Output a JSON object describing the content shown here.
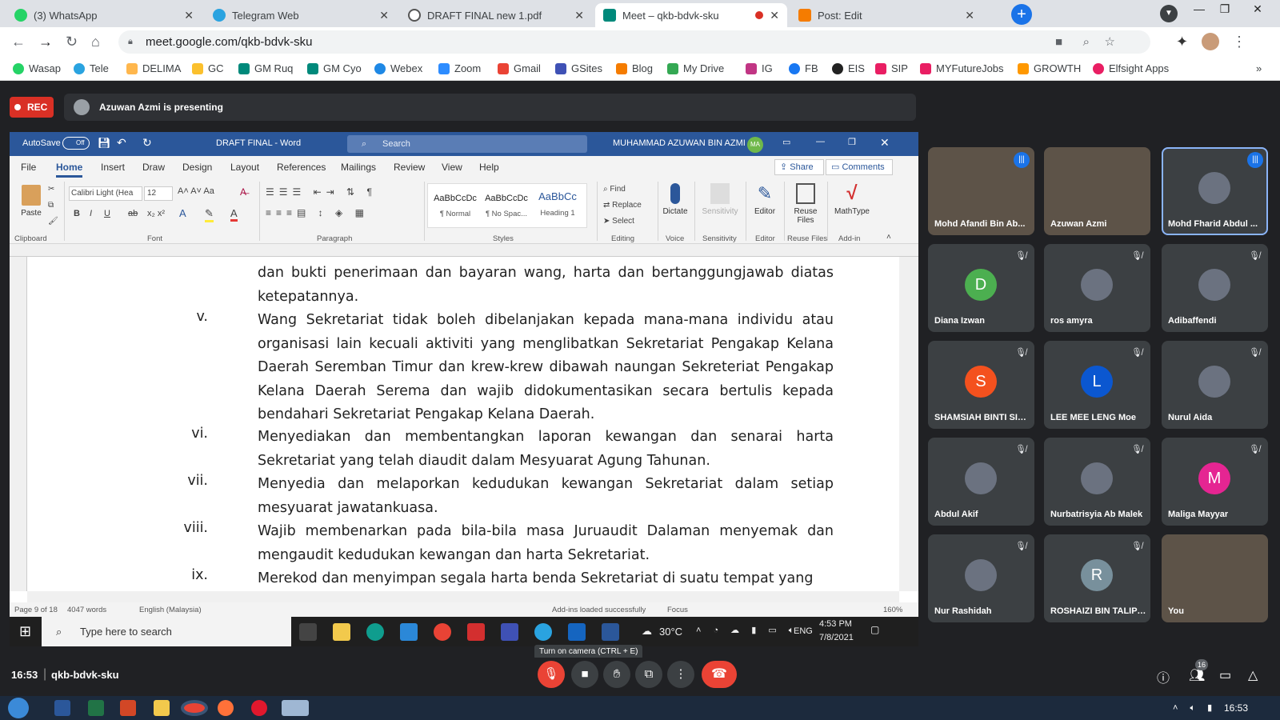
{
  "browser": {
    "tabs": [
      {
        "label": "(3) WhatsApp",
        "color": "#25d366"
      },
      {
        "label": "Telegram Web",
        "color": "#2aa3e0"
      },
      {
        "label": "DRAFT FINAL new 1.pdf",
        "color": "#555555"
      },
      {
        "label": "Meet – qkb-bdvk-sku",
        "color": "#00897b"
      },
      {
        "label": "Post: Edit",
        "color": "#f57c00"
      }
    ],
    "url": "meet.google.com/qkb-bdvk-sku",
    "bookmarks": [
      "Wasap",
      "Tele",
      "DELIMA",
      "GC",
      "GM Ruq",
      "GM Cyo",
      "Webex",
      "Zoom",
      "Gmail",
      "GSites",
      "Blog",
      "My Drive",
      "IG",
      "FB",
      "EIS",
      "SIP",
      "MYFutureJobs",
      "GROWTH",
      "Elfsight Apps"
    ]
  },
  "meet": {
    "rec_label": "REC",
    "presenting": "Azuwan Azmi is presenting",
    "time": "16:53",
    "meeting_code": "qkb-bdvk-sku",
    "tooltip": "Turn on camera (CTRL + E)",
    "people_count": "16",
    "participants": [
      {
        "name": "Mohd Afandi Bin Ab...",
        "kind": "video"
      },
      {
        "name": "Azuwan Azmi",
        "kind": "video"
      },
      {
        "name": "Mohd Fharid Abdul ...",
        "kind": "photo"
      },
      {
        "name": "Diana Izwan",
        "kind": "letter",
        "letter": "D",
        "color": "#4caf50"
      },
      {
        "name": "ros amyra",
        "kind": "photo"
      },
      {
        "name": "Adibaffendi",
        "kind": "photo"
      },
      {
        "name": "SHAMSIAH BINTI SID...",
        "kind": "letter",
        "letter": "S",
        "color": "#f4511e"
      },
      {
        "name": "LEE MEE LENG Moe",
        "kind": "letter",
        "letter": "L",
        "color": "#0b57d0"
      },
      {
        "name": "Nurul Aida",
        "kind": "photo"
      },
      {
        "name": "Abdul Akif",
        "kind": "photo"
      },
      {
        "name": "Nurbatrisyia Ab Malek",
        "kind": "photo"
      },
      {
        "name": "Maliga Mayyar",
        "kind": "letter",
        "letter": "M",
        "color": "#e52592"
      },
      {
        "name": "Nur Rashidah",
        "kind": "photo"
      },
      {
        "name": "ROSHAIZI BIN TALIP ...",
        "kind": "letter",
        "letter": "R",
        "color": "#78909c"
      },
      {
        "name": "You",
        "kind": "video"
      }
    ]
  },
  "word": {
    "autosave": "AutoSave",
    "autosave_state": "Off",
    "title": "DRAFT FINAL - Word",
    "search": "Search",
    "user": "MUHAMMAD AZUWAN BIN AZMI",
    "user_initials": "MA",
    "share": "Share",
    "comments": "Comments",
    "menu": [
      "File",
      "Home",
      "Insert",
      "Draw",
      "Design",
      "Layout",
      "References",
      "Mailings",
      "Review",
      "View",
      "Help"
    ],
    "font": "Calibri Light (Hea",
    "size": "12",
    "styles": [
      {
        "preview": "AaBbCcDc",
        "name": "¶ Normal"
      },
      {
        "preview": "AaBbCcDc",
        "name": "¶ No Spac..."
      },
      {
        "preview": "AaBbCc",
        "name": "Heading 1"
      }
    ],
    "editing": [
      "Find",
      "Replace",
      "Select"
    ],
    "buttons": [
      "Dictate",
      "Sensitivity",
      "Editor",
      "Reuse Files",
      "MathType"
    ],
    "groups": [
      "Clipboard",
      "Font",
      "Paragraph",
      "Styles",
      "Editing",
      "Voice",
      "Sensitivity",
      "Editor",
      "Reuse Files",
      "Add-in"
    ],
    "paste": "Paste",
    "status": {
      "page": "Page 9 of 18",
      "words": "4047 words",
      "lang": "English (Malaysia)",
      "addins": "Add-ins loaded successfully",
      "focus": "Focus",
      "zoom": "160%"
    },
    "items": [
      {
        "num": "",
        "text": "dan bukti penerimaan dan bayaran wang, harta dan bertanggungjawab diatas ketepatannya."
      },
      {
        "num": "v.",
        "text": "Wang Sekretariat tidak boleh dibelanjakan kepada mana-mana individu atau organisasi lain kecuali aktiviti yang menglibatkan Sekretariat Pengakap Kelana Daerah Seremban Timur dan krew-krew dibawah naungan Sekreteriat Pengakap Kelana Daerah Serema dan wajib didokumentasikan secara bertulis kepada bendahari Sekretariat Pengakap Kelana Daerah."
      },
      {
        "num": "vi.",
        "text": "Menyediakan dan membentangkan laporan kewangan dan senarai harta Sekretariat yang telah diaudit dalam Mesyuarat Agung Tahunan."
      },
      {
        "num": "vii.",
        "text": "Menyedia dan melaporkan kedudukan kewangan Sekretariat dalam setiap mesyuarat jawatankuasa."
      },
      {
        "num": "viii.",
        "text": "Wajib membenarkan pada bila-bila masa Juruaudit Dalaman menyemak dan mengaudit kedudukan kewangan dan harta Sekretariat."
      },
      {
        "num": "ix.",
        "text": "Merekod dan menyimpan segala harta benda Sekretariat di suatu tempat yang"
      }
    ]
  },
  "windows": {
    "search_placeholder": "Type here to search",
    "weather": "30°C",
    "lang": "ENG",
    "time": "4:53 PM",
    "date": "7/8/2021",
    "notif": "1",
    "clock": "16:53"
  }
}
